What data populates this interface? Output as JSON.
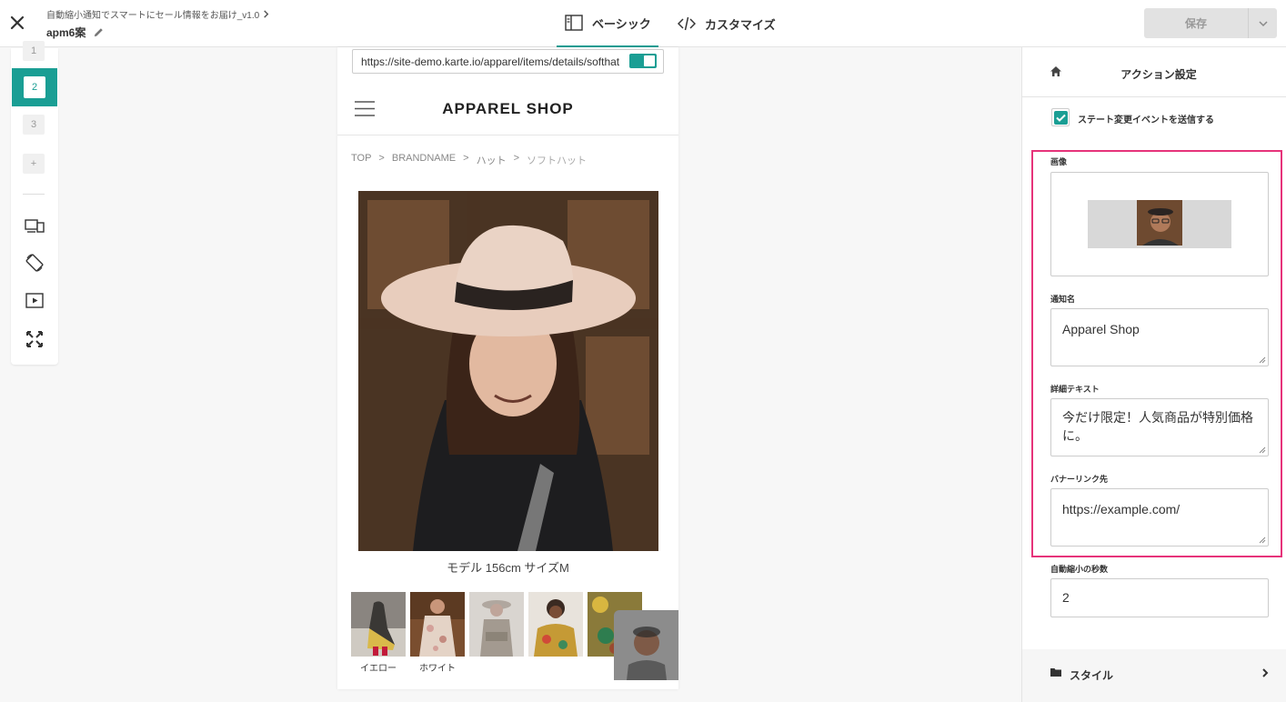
{
  "header": {
    "campaign_name": "自動縮小通知でスマートにセール情報をお届け_v1.0",
    "variant_name": "apm6案",
    "tabs": [
      {
        "label": "ベーシック",
        "active": true
      },
      {
        "label": "カスタマイズ",
        "active": false
      }
    ],
    "save_label": "保存"
  },
  "rail": {
    "steps": [
      "1",
      "2",
      "3",
      "+"
    ],
    "active_step": "2",
    "tools": [
      "responsive-icon",
      "rotate-icon",
      "play-icon",
      "expand-icon"
    ]
  },
  "preview": {
    "url": "https://site-demo.karte.io/apparel/items/details/softhat",
    "shop_name": "APPAREL SHOP",
    "breadcrumb": [
      "TOP",
      ">",
      "BRANDNAME",
      ">",
      "ハット",
      ">",
      "ソフトハット"
    ],
    "caption": "モデル 156cm サイズM",
    "thumbnails": [
      {
        "label": "イエロー"
      },
      {
        "label": "ホワイト"
      },
      {
        "label": ""
      },
      {
        "label": ""
      },
      {
        "label": ""
      }
    ]
  },
  "panel": {
    "title": "アクション設定",
    "send_state_event_label": "ステート変更イベントを送信する",
    "send_state_event_checked": true,
    "image_label": "画像",
    "notification_name_label": "通知名",
    "notification_name_value": "Apparel Shop",
    "detail_text_label": "詳細テキスト",
    "detail_text_value": "今だけ限定！人気商品が特別価格に。",
    "banner_link_label": "バナーリンク先",
    "banner_link_value": "https://example.com/",
    "auto_shrink_label": "自動縮小の秒数",
    "auto_shrink_value": "2",
    "style_section_label": "スタイル"
  },
  "colors": {
    "accent": "#1a9e94",
    "highlight": "#e6337a",
    "save_disabled_bg": "#e2e2e2"
  }
}
